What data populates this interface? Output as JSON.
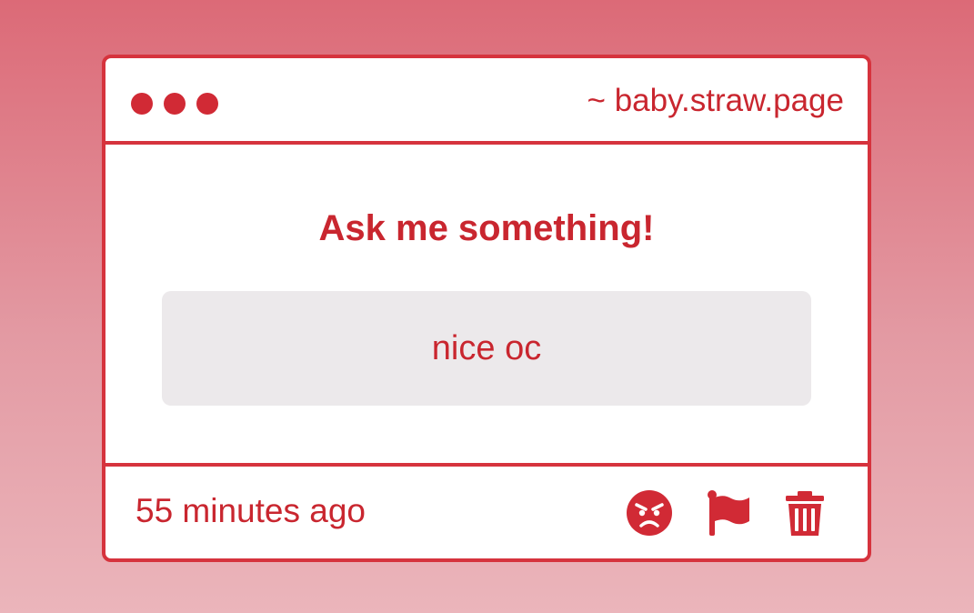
{
  "window": {
    "url": "~ baby.straw.page",
    "dots": [
      "window-dot",
      "window-dot",
      "window-dot"
    ]
  },
  "main": {
    "prompt": "Ask me something!",
    "question": "nice oc"
  },
  "footer": {
    "timestamp": "55 minutes ago",
    "actions": [
      "angry-face-icon",
      "flag-icon",
      "trash-icon"
    ]
  },
  "colors": {
    "accent": "#d6333d",
    "text": "#c9262f",
    "box": "#ece9eb",
    "background_top": "#dc6a77",
    "background_bottom": "#ebb5bb"
  }
}
